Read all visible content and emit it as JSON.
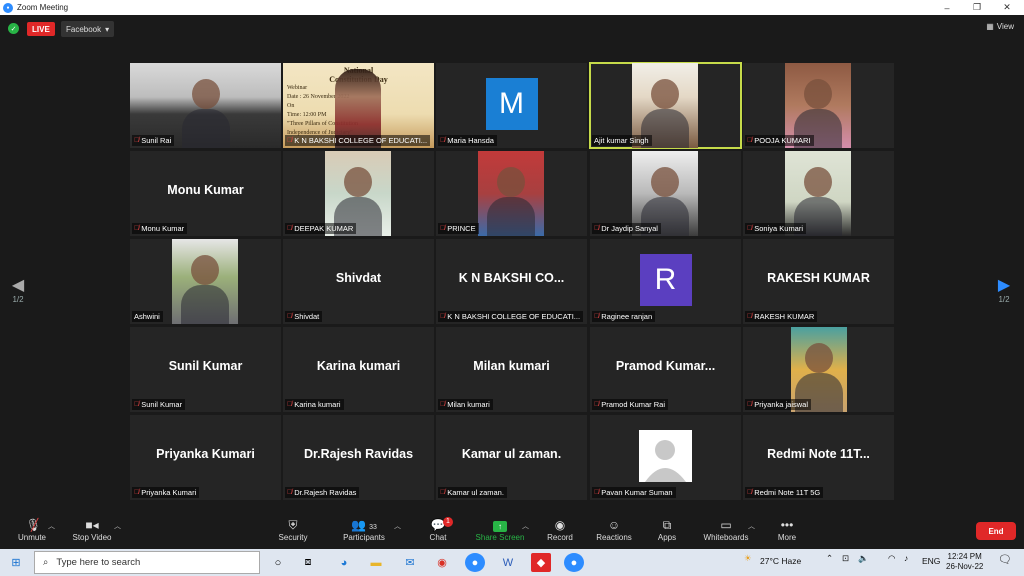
{
  "window": {
    "title": "Zoom Meeting",
    "controls": [
      "–",
      "❐",
      "✕"
    ]
  },
  "topbar": {
    "live_label": "LIVE",
    "stream_target": "Facebook",
    "view_label": "View"
  },
  "nav": {
    "page_left": "1/2",
    "page_right": "1/2"
  },
  "tiles": [
    {
      "big": "",
      "label": "Sunil Rai",
      "video": "man-suit",
      "muted": true
    },
    {
      "big": "",
      "label": "K N BAKSHI COLLEGE OF EDUCATI...",
      "video": "banner",
      "muted": true,
      "banner_lines": [
        "National",
        "Constitution Day",
        "Webinar",
        "Date : 26 November 2022",
        "On",
        "Time: 12:00 PM",
        "\"Three Pillars of Constitution",
        "Independence of Judiciary\""
      ]
    },
    {
      "big": "",
      "label": "Maria Hansda",
      "avatar": "M",
      "avatar_color": "#1a7fd4",
      "muted": true
    },
    {
      "big": "",
      "label": "Ajit kumar Singh",
      "video": "man-speaking",
      "muted": false,
      "active": true
    },
    {
      "big": "",
      "label": "POOJA KUMARI",
      "video": "woman-brick",
      "muted": true
    },
    {
      "big": "Monu Kumar",
      "label": "Monu Kumar",
      "muted": true
    },
    {
      "big": "",
      "label": "DEEPAK KUMAR",
      "video": "man-map",
      "muted": true
    },
    {
      "big": "",
      "label": "PRINCE",
      "video": "man-red",
      "muted": true
    },
    {
      "big": "",
      "label": "Dr Jaydip Sanyal",
      "video": "man-window",
      "muted": true
    },
    {
      "big": "",
      "label": "Soniya Kumari",
      "video": "room-fan",
      "muted": true
    },
    {
      "big": "",
      "label": "Ashwini",
      "video": "man-outdoor",
      "muted": false
    },
    {
      "big": "Shivdat",
      "label": "Shivdat",
      "muted": true
    },
    {
      "big": "K N BAKSHI CO...",
      "label": "K N BAKSHI COLLEGE OF EDUCATI...",
      "muted": true
    },
    {
      "big": "",
      "label": "Raginee ranjan",
      "avatar": "R",
      "avatar_color": "#5b3fc0",
      "muted": true
    },
    {
      "big": "RAKESH KUMAR",
      "label": "RAKESH KUMAR",
      "muted": true
    },
    {
      "big": "Sunil Kumar",
      "label": "Sunil Kumar",
      "muted": true
    },
    {
      "big": "Karina kumari",
      "label": "Karina kumari",
      "muted": true
    },
    {
      "big": "Milan kumari",
      "label": "Milan kumari",
      "muted": true
    },
    {
      "big": "Pramod  Kumar...",
      "label": "Pramod Kumar Rai",
      "muted": true
    },
    {
      "big": "",
      "label": "Priyanka jaiswal",
      "video": "deity-image",
      "muted": true
    },
    {
      "big": "Priyanka Kumari",
      "label": "Priyanka Kumari",
      "muted": true
    },
    {
      "big": "Dr.Rajesh Ravidas",
      "label": "Dr.Rajesh Ravidas",
      "muted": true
    },
    {
      "big": "Kamar ul zaman.",
      "label": "Kamar ul zaman.",
      "muted": true
    },
    {
      "big": "",
      "label": "Pavan Kumar Suman",
      "video": "placeholder-person",
      "muted": true
    },
    {
      "big": "Redmi  Note  11T...",
      "label": "Redmi Note 11T 5G",
      "muted": true
    }
  ],
  "toolbar": {
    "unmute": "Unmute",
    "stop_video": "Stop Video",
    "security": "Security",
    "participants": "Participants",
    "participants_count": "33",
    "chat": "Chat",
    "chat_badge": "1",
    "share": "Share Screen",
    "record": "Record",
    "reactions": "Reactions",
    "apps": "Apps",
    "whiteboards": "Whiteboards",
    "more": "More",
    "end": "End"
  },
  "taskbar": {
    "search_placeholder": "Type here to search",
    "weather": "27°C  Haze",
    "lang": "ENG",
    "time": "12:24 PM",
    "date": "26-Nov-22"
  },
  "colors": {
    "accent": "#2d8cff",
    "live": "#e02828",
    "active_speaker": "#c6db4a",
    "share_green": "#28b446"
  }
}
